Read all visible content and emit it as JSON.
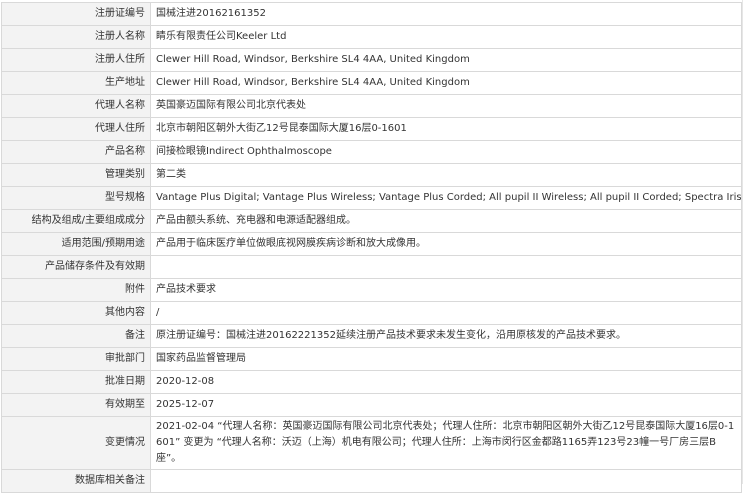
{
  "rows": [
    {
      "label": "注册证编号",
      "value": "国械注进20162161352"
    },
    {
      "label": "注册人名称",
      "value": "睛乐有限责任公司Keeler Ltd"
    },
    {
      "label": "注册人住所",
      "value": "Clewer Hill Road, Windsor, Berkshire SL4 4AA, United Kingdom"
    },
    {
      "label": "生产地址",
      "value": "Clewer Hill Road, Windsor, Berkshire SL4 4AA, United Kingdom"
    },
    {
      "label": "代理人名称",
      "value": "英国豪迈国际有限公司北京代表处"
    },
    {
      "label": "代理人住所",
      "value": "北京市朝阳区朝外大街乙12号昆泰国际大厦16层0-1601"
    },
    {
      "label": "产品名称",
      "value": "间接检眼镜Indirect Ophthalmoscope"
    },
    {
      "label": "管理类别",
      "value": "第二类"
    },
    {
      "label": "型号规格",
      "value": "Vantage Plus Digital; Vantage Plus Wireless; Vantage Plus Corded; All pupil II Wireless; All pupil II Corded; Spectra Iris"
    },
    {
      "label": "结构及组成/主要组成成分",
      "value": "产品由额头系统、充电器和电源适配器组成。"
    },
    {
      "label": "适用范围/预期用途",
      "value": "产品用于临床医疗单位做眼底视网膜疾病诊断和放大成像用。"
    },
    {
      "label": "产品储存条件及有效期",
      "value": ""
    },
    {
      "label": "附件",
      "value": "产品技术要求"
    },
    {
      "label": "其他内容",
      "value": "/"
    },
    {
      "label": "备注",
      "value": "原注册证编号：国械注进20162221352延续注册产品技术要求未发生变化，沿用原核发的产品技术要求。"
    },
    {
      "label": "审批部门",
      "value": "国家药品监督管理局"
    },
    {
      "label": "批准日期",
      "value": "2020-12-08"
    },
    {
      "label": "有效期至",
      "value": "2025-12-07"
    },
    {
      "label": "变更情况",
      "value": "2021-02-04 “代理人名称：英国豪迈国际有限公司北京代表处；代理人住所：北京市朝阳区朝外大街乙12号昆泰国际大厦16层0-1601” 变更为 “代理人名称：沃迈（上海）机电有限公司；代理人住所：上海市闵行区金都路1165弄123号23幢一号厂房三层B座”。"
    },
    {
      "label": "数据库相关备注",
      "value": ""
    }
  ]
}
